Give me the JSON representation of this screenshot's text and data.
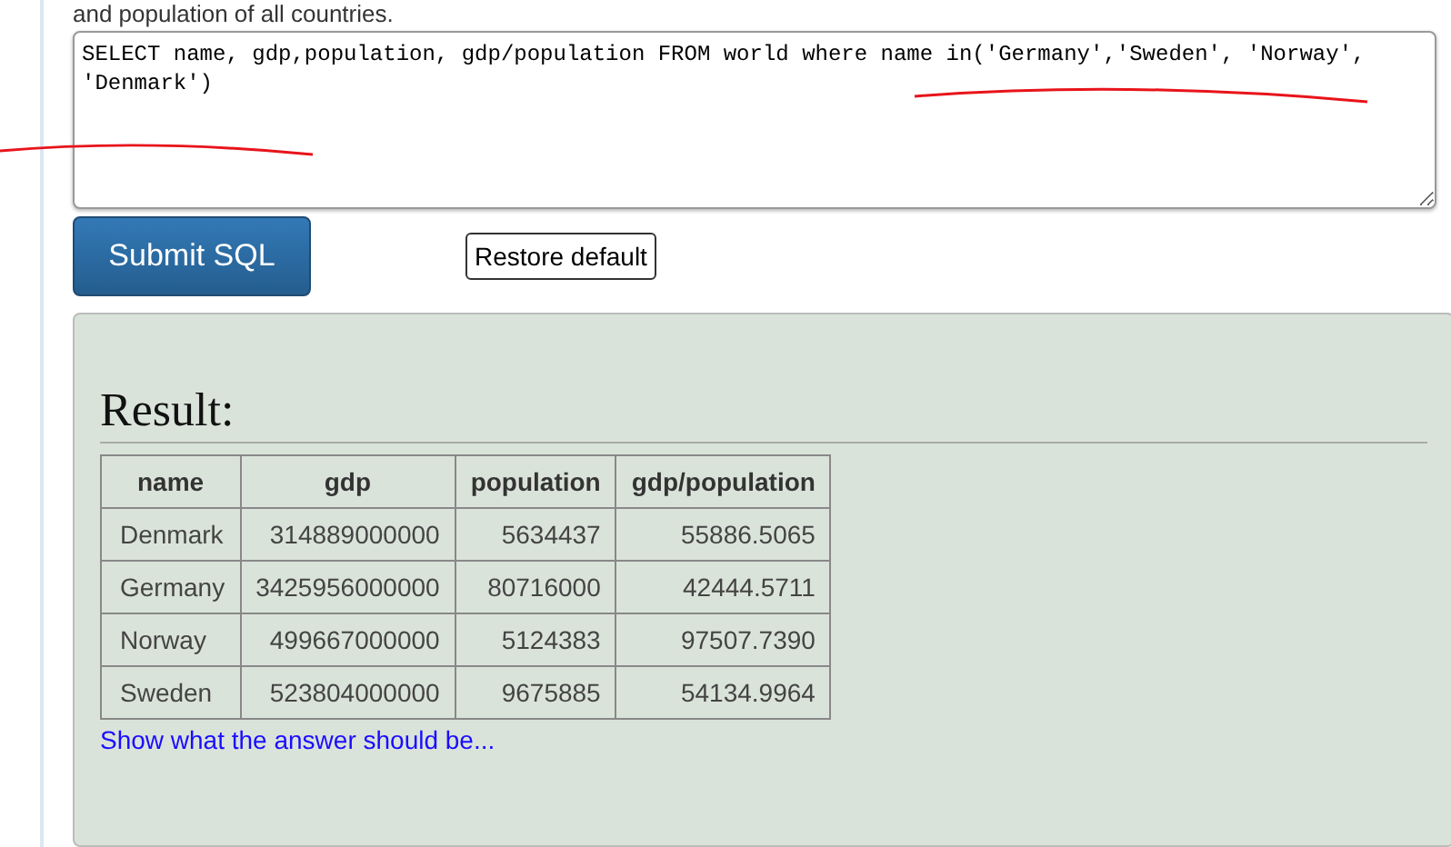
{
  "intro": "and population of all countries.",
  "sql_editor": {
    "value": "SELECT name, gdp,population, gdp/population FROM world where name in('Germany','Sweden', 'Norway', 'Denmark')"
  },
  "buttons": {
    "submit": "Submit SQL",
    "restore": "Restore default"
  },
  "result": {
    "heading": "Result:",
    "table": {
      "columns": [
        "name",
        "gdp",
        "population",
        "gdp/population"
      ],
      "rows": [
        [
          "Denmark",
          "314889000000",
          "5634437",
          "55886.5065"
        ],
        [
          "Germany",
          "3425956000000",
          "80716000",
          "42444.5711"
        ],
        [
          "Norway",
          "499667000000",
          "5124383",
          "97507.7390"
        ],
        [
          "Sweden",
          "523804000000",
          "9675885",
          "54134.9964"
        ]
      ]
    },
    "answer_link": "Show what the answer should be..."
  }
}
